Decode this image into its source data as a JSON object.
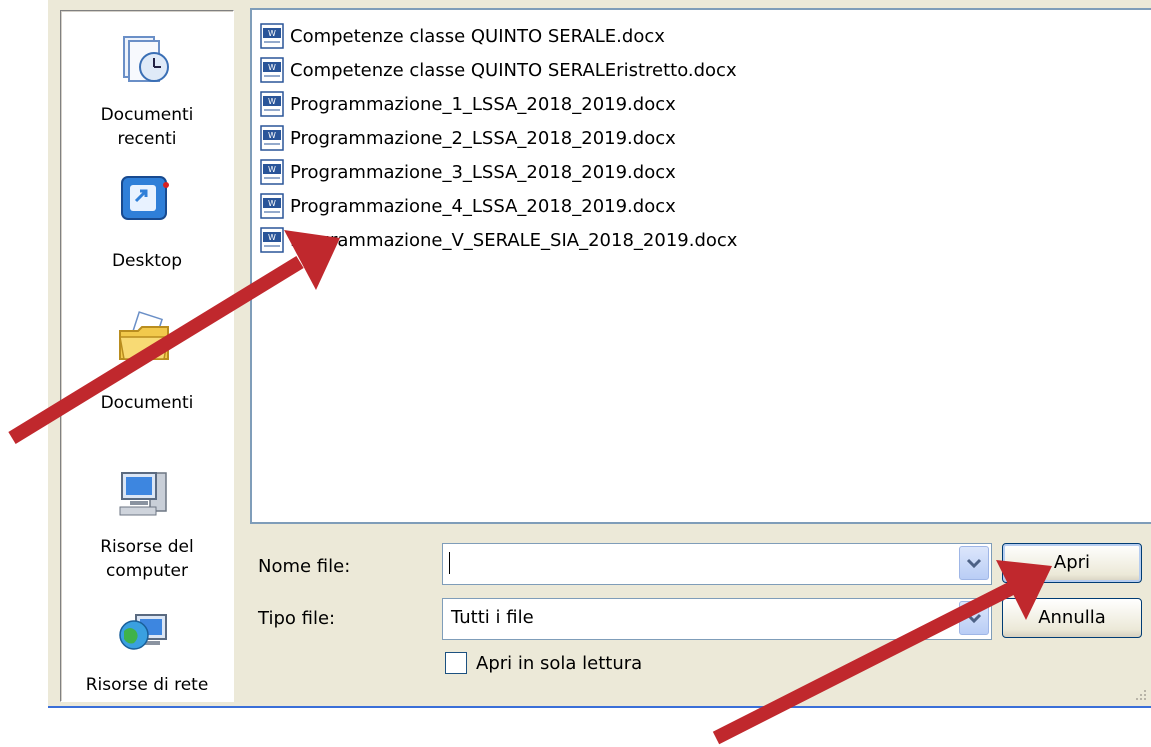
{
  "places": [
    {
      "name": "recent",
      "label_line1": "Documenti",
      "label_line2": "recenti",
      "icon": "recent-documents-icon"
    },
    {
      "name": "desktop",
      "label_line1": "Desktop",
      "label_line2": "",
      "icon": "desktop-icon"
    },
    {
      "name": "documents",
      "label_line1": "Documenti",
      "label_line2": "",
      "icon": "documents-folder-icon"
    },
    {
      "name": "computer",
      "label_line1": "Risorse del",
      "label_line2": "computer",
      "icon": "my-computer-icon"
    },
    {
      "name": "network",
      "label_line1": "Risorse di rete",
      "label_line2": "",
      "icon": "network-places-icon"
    }
  ],
  "files": [
    "Competenze classe QUINTO SERALE.docx",
    "Competenze classe QUINTO SERALEristretto.docx",
    "Programmazione_1_LSSA_2018_2019.docx",
    "Programmazione_2_LSSA_2018_2019.docx",
    "Programmazione_3_LSSA_2018_2019.docx",
    "Programmazione_4_LSSA_2018_2019.docx",
    "Programmazione_V_SERALE_SIA_2018_2019.docx"
  ],
  "form": {
    "filename_label": "Nome file:",
    "filename_value": "",
    "filetype_label": "Tipo file:",
    "filetype_value": "Tutti i file",
    "readonly_label": "Apri in sola lettura",
    "readonly_checked": false
  },
  "buttons": {
    "open": "Apri",
    "cancel": "Annulla"
  },
  "colors": {
    "dialog_bg": "#ece9d8",
    "annotation_arrow": "#c0282d",
    "field_border": "#7f9db9"
  }
}
